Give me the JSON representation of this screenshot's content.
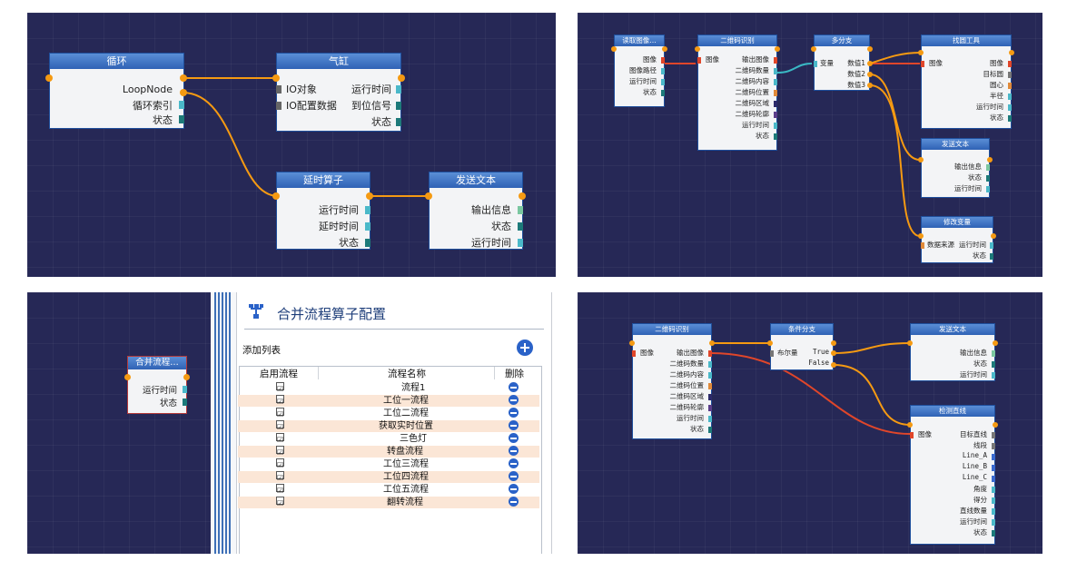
{
  "panel1": {
    "loop": {
      "title": "循环",
      "rows": [
        "LoopNode",
        "循环索引",
        "状态"
      ]
    },
    "cylinder": {
      "title": "气缸",
      "left_rows": [
        "IO对象",
        "IO配置数据"
      ],
      "right_rows": [
        "运行时间",
        "到位信号",
        "状态"
      ]
    },
    "delay": {
      "title": "延时算子",
      "rows": [
        "运行时间",
        "延时时间",
        "状态"
      ]
    },
    "send": {
      "title": "发送文本",
      "rows": [
        "输出信息",
        "状态",
        "运行时间"
      ]
    }
  },
  "panel2": {
    "read": {
      "title": "读取图像…",
      "rows": [
        "图像",
        "图像路径",
        "运行时间",
        "状态"
      ]
    },
    "qr": {
      "title": "二维码识别",
      "input": "图像",
      "rows": [
        "输出图像",
        "二维码数量",
        "二维码内容",
        "二维码位置",
        "二维码区域",
        "二维码轮廓",
        "运行时间",
        "状态"
      ]
    },
    "branch": {
      "title": "多分支",
      "input": "变量",
      "rows": [
        "数值1",
        "数值2",
        "数值3"
      ]
    },
    "find": {
      "title": "找圆工具",
      "input": "图像",
      "rows": [
        "图像",
        "目标圆",
        "圆心",
        "半径",
        "运行时间",
        "状态"
      ]
    },
    "send": {
      "title": "发送文本",
      "rows": [
        "输出信息",
        "状态",
        "运行时间"
      ]
    },
    "modify": {
      "title": "修改变量",
      "input": "数据来源",
      "rows": [
        "运行时间",
        "状态"
      ]
    }
  },
  "panel3": {
    "merge_node": {
      "title": "合并流程…",
      "rows": [
        "运行时间",
        "状态"
      ]
    },
    "config_title": "合并流程算子配置",
    "list_label": "添加列表",
    "columns": [
      "启用流程",
      "流程名称",
      "删除"
    ],
    "flows": [
      "流程1",
      "工位一流程",
      "工位二流程",
      "获取实时位置",
      "三色灯",
      "转盘流程",
      "工位三流程",
      "工位四流程",
      "工位五流程",
      "翻转流程"
    ],
    "check_mark": "☑"
  },
  "panel4": {
    "qr": {
      "title": "二维码识别",
      "input": "图像",
      "rows": [
        "输出图像",
        "二维码数量",
        "二维码内容",
        "二维码位置",
        "二维码区域",
        "二维码轮廓",
        "运行时间",
        "状态"
      ]
    },
    "cond": {
      "title": "条件分支",
      "input": "布尔量",
      "rows": [
        "True",
        "False"
      ]
    },
    "send": {
      "title": "发送文本",
      "rows": [
        "输出信息",
        "状态",
        "运行时间"
      ]
    },
    "line": {
      "title": "检测直线",
      "input": "图像",
      "rows": [
        "目标直线",
        "线段",
        "Line_A",
        "Line_B",
        "Line_C",
        "角度",
        "得分",
        "直线数量",
        "运行时间",
        "状态"
      ]
    }
  },
  "colors": {
    "canvas": "#262856",
    "header": "#3568b8",
    "wire": "#f59a12",
    "wire_red": "#e0462a",
    "wire_teal": "#3ab8c4",
    "port_teal": "#4ab8c9",
    "port_gray": "#666"
  }
}
